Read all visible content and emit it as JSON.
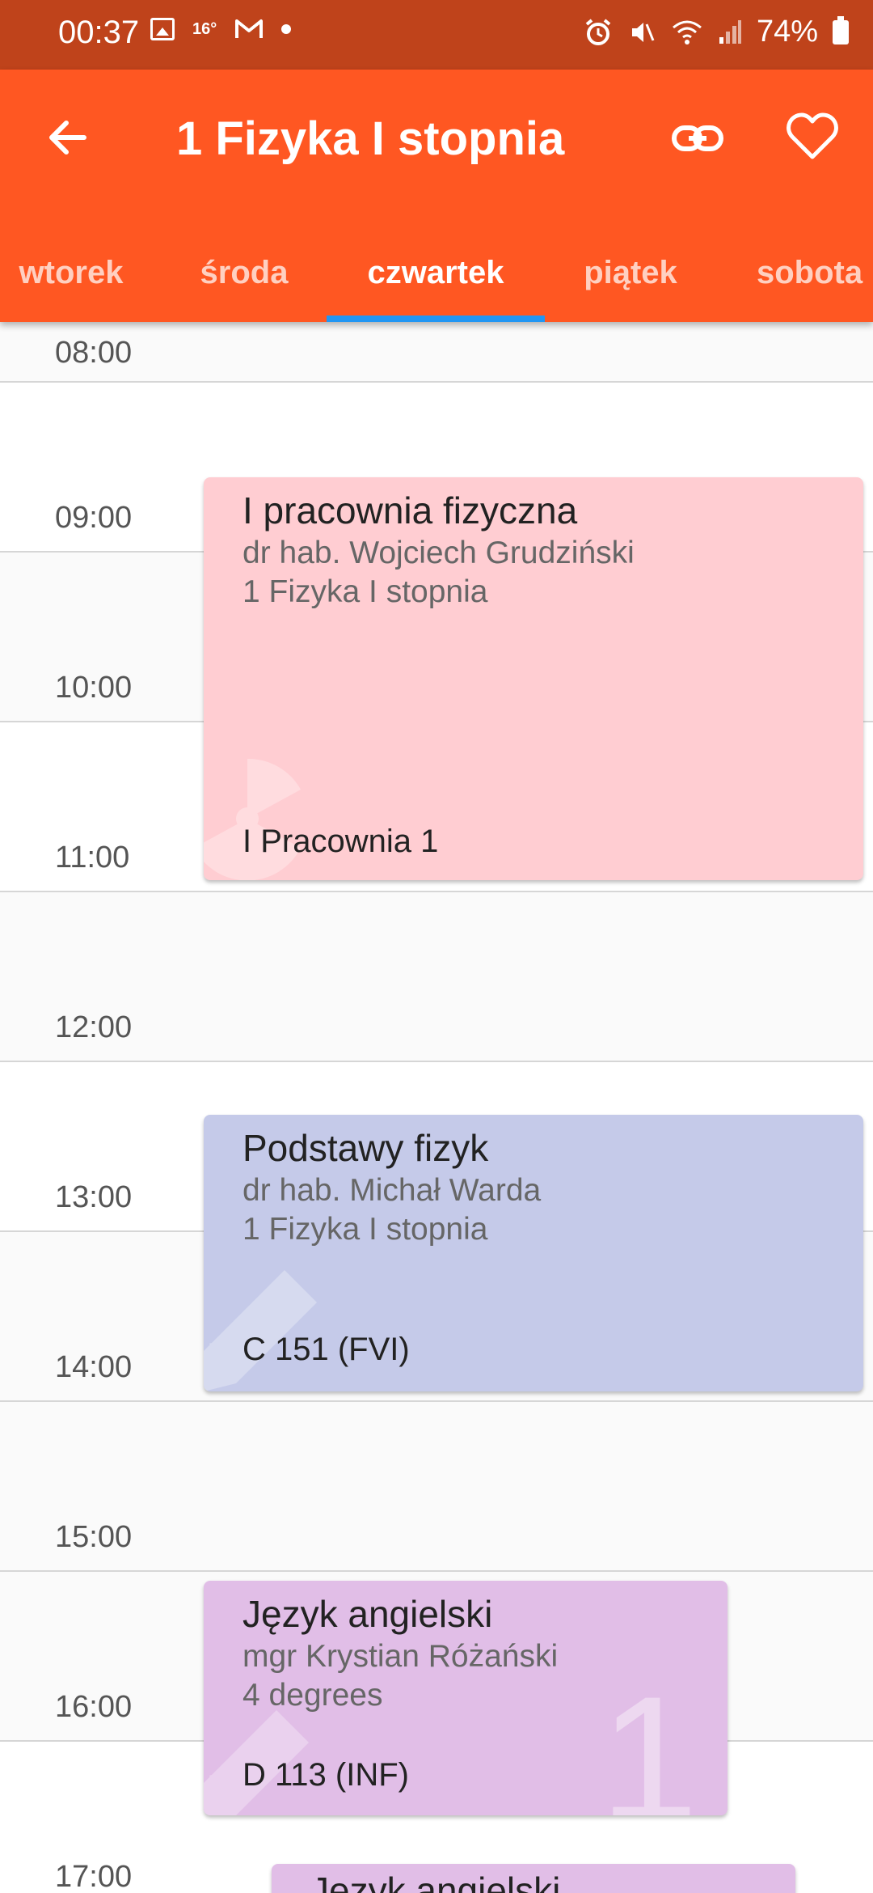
{
  "status_bar": {
    "time": "00:37",
    "notif_small": "16°",
    "battery": "74%",
    "icons": [
      "gallery-icon",
      "temperature-icon",
      "gmail-icon",
      "dot-icon",
      "alarm-icon",
      "mute-icon",
      "wifi-icon",
      "signal-icon",
      "battery-icon"
    ]
  },
  "app_bar": {
    "title": "1 Fizyka I stopnia",
    "icons": [
      "back-arrow-icon",
      "link-icon",
      "heart-icon"
    ]
  },
  "tabs": [
    "wtorek",
    "środa",
    "czwartek",
    "piątek",
    "sobota"
  ],
  "active_tab": "czwartek",
  "colors": {
    "status_bar": "#bf431b",
    "app_bar": "#ff5722",
    "tab_indicator": "#2196f3",
    "event_1": "#ffcdd2",
    "event_2": "#c5cae9",
    "event_3": "#e1bee7"
  },
  "timeline": {
    "hours": [
      "08:00",
      "09:00",
      "10:00",
      "11:00",
      "12:00",
      "13:00",
      "14:00",
      "15:00",
      "16:00",
      "17:00"
    ]
  },
  "events": [
    {
      "title": "I pracownia fizyczna",
      "lecturer": "dr hab. Wojciech Grudziński",
      "group": "1 Fizyka I stopnia",
      "room": "I Pracownia 1",
      "icon": "radiation-icon"
    },
    {
      "title": "Podstawy fizyk",
      "lecturer": "dr hab. Michał Warda",
      "group": "1 Fizyka I stopnia",
      "room": "C 151 (FVI)",
      "icon": "pencil-icon"
    },
    {
      "title": "Język angielski",
      "lecturer": "mgr Krystian Różański",
      "group": "4 degrees",
      "room": "D 113 (INF)",
      "icon": "pencil-icon",
      "badge": "1"
    },
    {
      "title": "Język angielski"
    }
  ]
}
